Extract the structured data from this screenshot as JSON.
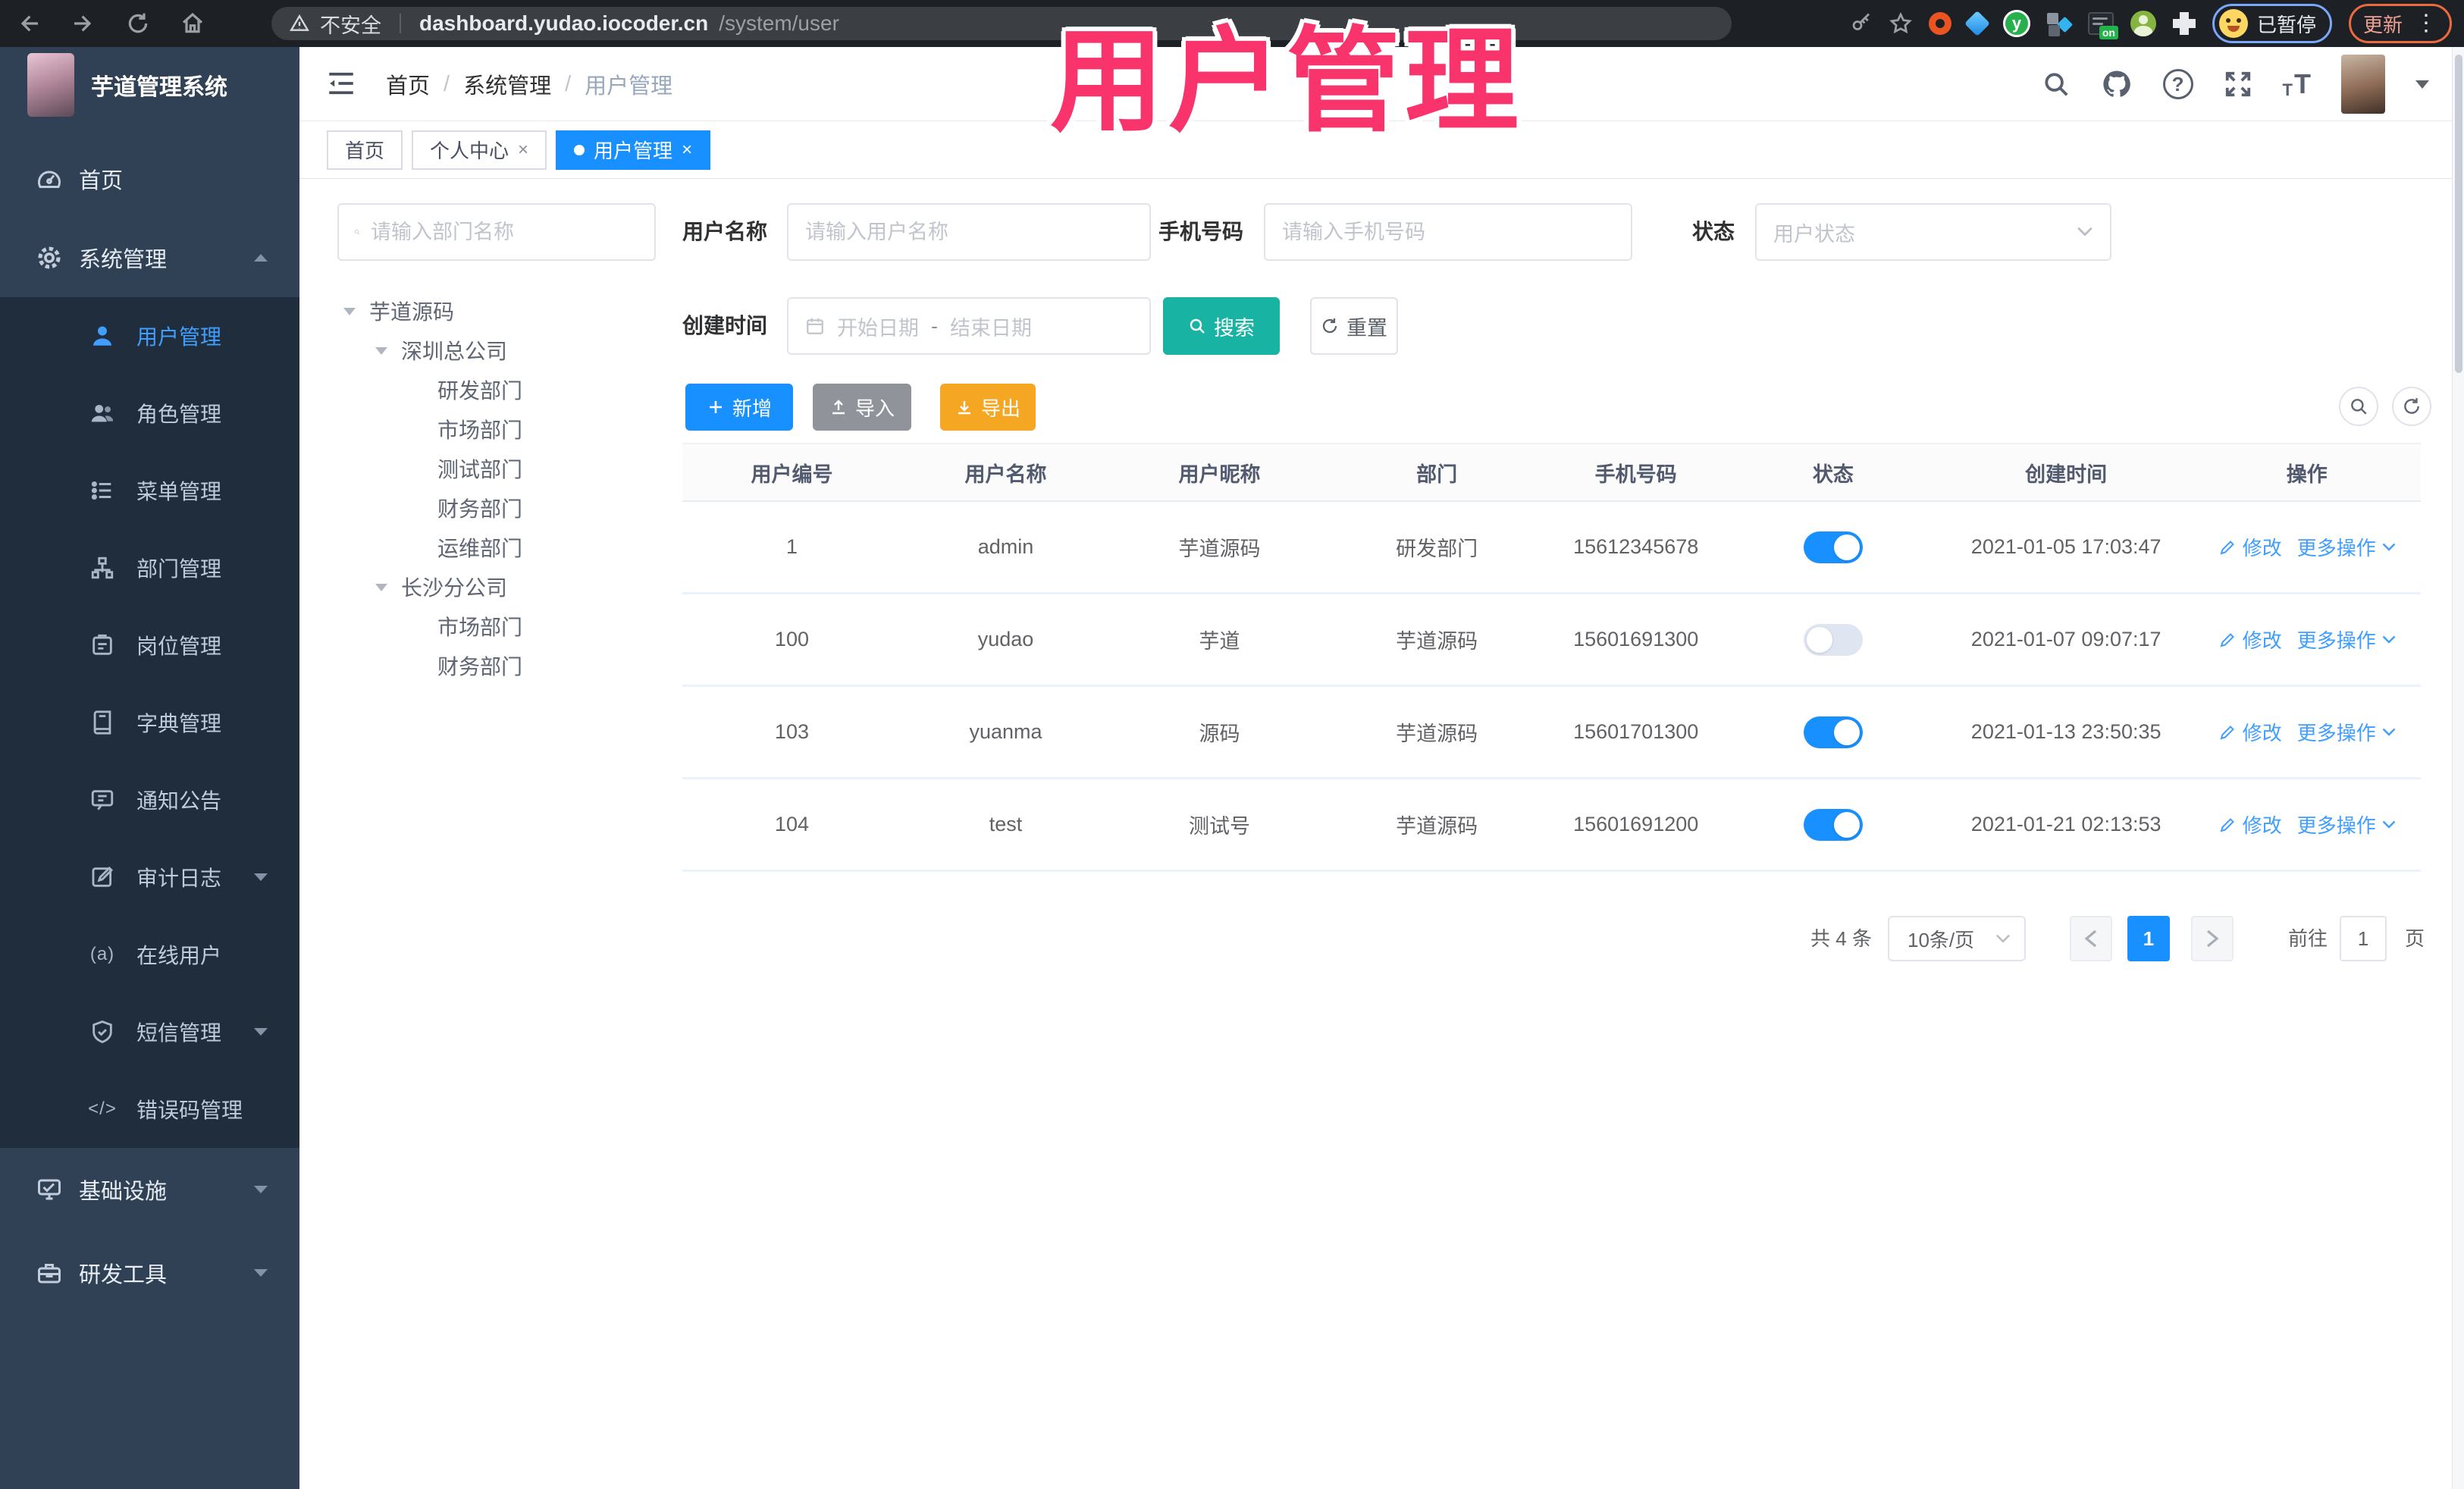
{
  "browser": {
    "insecure_label": "不安全",
    "url_host": "dashboard.yudao.iocoder.cn",
    "url_path": "/system/user",
    "profile_status": "已暂停",
    "update_label": "更新",
    "extension_on_badge": "on"
  },
  "annotation": {
    "title": "用户管理"
  },
  "icons": {
    "close_glyph": "×",
    "more_ellipsis": "⋮",
    "star_glyph": "☆",
    "help_glyph": "?",
    "font_large": "T",
    "font_small": "T",
    "online_glyph": "(a)",
    "code_glyph": "</>",
    "extension_y": "y",
    "prev_glyph": "‹",
    "next_glyph": "›"
  },
  "sidebar": {
    "logo_title": "芋道管理系统",
    "items": [
      {
        "label": "首页",
        "icon": "dashboard-icon"
      },
      {
        "label": "系统管理",
        "icon": "gear-icon",
        "expanded": true
      }
    ],
    "submenu": [
      {
        "label": "用户管理",
        "active": true
      },
      {
        "label": "角色管理"
      },
      {
        "label": "菜单管理"
      },
      {
        "label": "部门管理"
      },
      {
        "label": "岗位管理"
      },
      {
        "label": "字典管理"
      },
      {
        "label": "通知公告"
      },
      {
        "label": "审计日志",
        "collapsible": true
      },
      {
        "label": "在线用户"
      },
      {
        "label": "短信管理",
        "collapsible": true
      },
      {
        "label": "错误码管理"
      }
    ],
    "bottom_items": [
      {
        "label": "基础设施",
        "collapsible": true
      },
      {
        "label": "研发工具",
        "collapsible": true
      }
    ]
  },
  "header": {
    "breadcrumb": [
      "首页",
      "系统管理",
      "用户管理"
    ]
  },
  "tabs": {
    "items": [
      {
        "label": "首页",
        "closable": false,
        "active": false
      },
      {
        "label": "个人中心",
        "closable": true,
        "active": false
      },
      {
        "label": "用户管理",
        "closable": true,
        "active": true
      }
    ]
  },
  "dept": {
    "search_placeholder": "请输入部门名称",
    "tree": [
      {
        "label": "芋道源码",
        "level": 1,
        "expandable": true
      },
      {
        "label": "深圳总公司",
        "level": 2,
        "expandable": true
      },
      {
        "label": "研发部门",
        "level": 3
      },
      {
        "label": "市场部门",
        "level": 3
      },
      {
        "label": "测试部门",
        "level": 3
      },
      {
        "label": "财务部门",
        "level": 3
      },
      {
        "label": "运维部门",
        "level": 3
      },
      {
        "label": "长沙分公司",
        "level": 2,
        "expandable": true
      },
      {
        "label": "市场部门",
        "level": 3
      },
      {
        "label": "财务部门",
        "level": 3
      }
    ]
  },
  "filters": {
    "username_label": "用户名称",
    "username_placeholder": "请输入用户名称",
    "mobile_label": "手机号码",
    "mobile_placeholder": "请输入手机号码",
    "status_label": "状态",
    "status_placeholder": "用户状态",
    "create_time_label": "创建时间",
    "date_start_placeholder": "开始日期",
    "date_range_separator": "-",
    "date_end_placeholder": "结束日期",
    "search_label": "搜索",
    "reset_label": "重置"
  },
  "toolbar": {
    "add_label": "新增",
    "import_label": "导入",
    "export_label": "导出"
  },
  "table": {
    "columns": [
      "用户编号",
      "用户名称",
      "用户昵称",
      "部门",
      "手机号码",
      "状态",
      "创建时间",
      "操作"
    ],
    "edit_label": "修改",
    "more_label": "更多操作",
    "rows": [
      {
        "id": "1",
        "username": "admin",
        "nickname": "芋道源码",
        "dept": "研发部门",
        "mobile": "15612345678",
        "status": true,
        "create_time": "2021-01-05 17:03:47"
      },
      {
        "id": "100",
        "username": "yudao",
        "nickname": "芋道",
        "dept": "芋道源码",
        "mobile": "15601691300",
        "status": false,
        "create_time": "2021-01-07 09:07:17"
      },
      {
        "id": "103",
        "username": "yuanma",
        "nickname": "源码",
        "dept": "芋道源码",
        "mobile": "15601701300",
        "status": true,
        "create_time": "2021-01-13 23:50:35"
      },
      {
        "id": "104",
        "username": "test",
        "nickname": "测试号",
        "dept": "芋道源码",
        "mobile": "15601691200",
        "status": true,
        "create_time": "2021-01-21 02:13:53"
      }
    ]
  },
  "pagination": {
    "total_label": "共 4 条",
    "page_size_label": "10条/页",
    "current_page": "1",
    "goto_label": "前往",
    "goto_value": "1",
    "unit_label": "页"
  },
  "colors": {
    "primary": "#1890ff",
    "link": "#409eff",
    "sidebar_active": "#409eff",
    "search_button": "#18b3a3",
    "export_button": "#f5a623",
    "import_button": "#909399",
    "annotation": "#f9336b",
    "sidebar_bg": "#304156",
    "submenu_bg": "#1f2d3d"
  }
}
